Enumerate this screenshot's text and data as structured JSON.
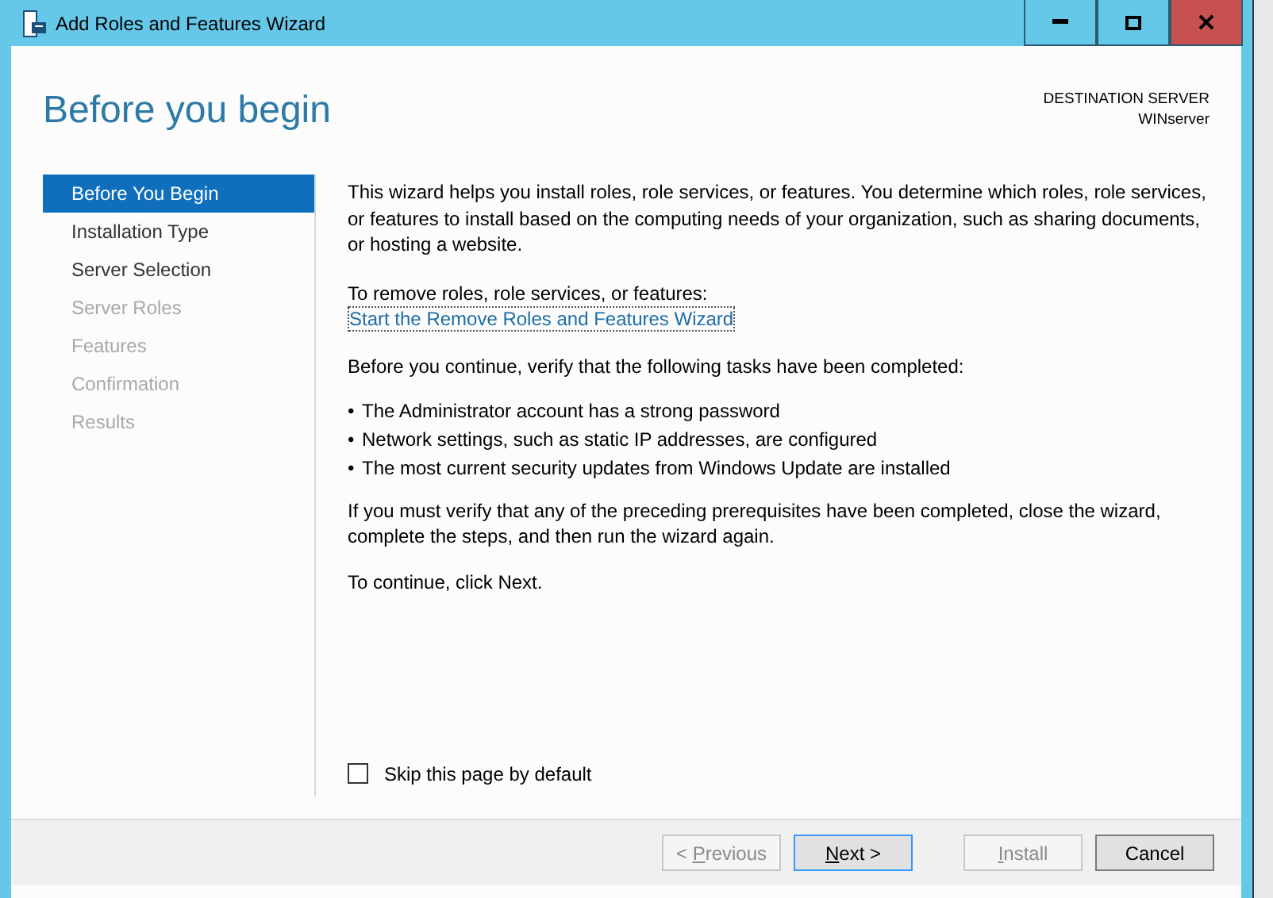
{
  "window": {
    "title": "Add Roles and Features Wizard"
  },
  "header": {
    "title": "Before you begin",
    "destination_label": "DESTINATION SERVER",
    "destination_server": "WINserver"
  },
  "sidebar": {
    "items": [
      {
        "label": "Before You Begin",
        "selected": true,
        "disabled": false
      },
      {
        "label": "Installation Type",
        "selected": false,
        "disabled": false
      },
      {
        "label": "Server Selection",
        "selected": false,
        "disabled": false
      },
      {
        "label": "Server Roles",
        "selected": false,
        "disabled": true
      },
      {
        "label": "Features",
        "selected": false,
        "disabled": true
      },
      {
        "label": "Confirmation",
        "selected": false,
        "disabled": true
      },
      {
        "label": "Results",
        "selected": false,
        "disabled": true
      }
    ]
  },
  "content": {
    "intro": "This wizard helps you install roles, role services, or features. You determine which roles, role services, or features to install based on the computing needs of your organization, such as sharing documents, or hosting a website.",
    "remove_label": "To remove roles, role services, or features:",
    "remove_link": "Start the Remove Roles and Features Wizard",
    "verify_text": "Before you continue, verify that the following tasks have been completed:",
    "bullets": [
      "The Administrator account has a strong password",
      "Network settings, such as static IP addresses, are configured",
      "The most current security updates from Windows Update are installed"
    ],
    "bullet_mark": "•",
    "prereq_text": "If you must verify that any of the preceding prerequisites have been completed, close the wizard, complete the steps, and then run the wizard again.",
    "continue_text": "To continue, click Next."
  },
  "skip_checkbox": {
    "label": "Skip this page by default",
    "checked": false
  },
  "buttons": [
    {
      "before": "< ",
      "key": "P",
      "after": "revious",
      "disabled": true,
      "default": false
    },
    {
      "key": "N",
      "after": "ext >",
      "disabled": false,
      "default": true
    },
    {
      "key": "I",
      "after": "nstall",
      "disabled": true,
      "default": false
    },
    {
      "before": "Cancel",
      "disabled": false,
      "default": false
    }
  ]
}
